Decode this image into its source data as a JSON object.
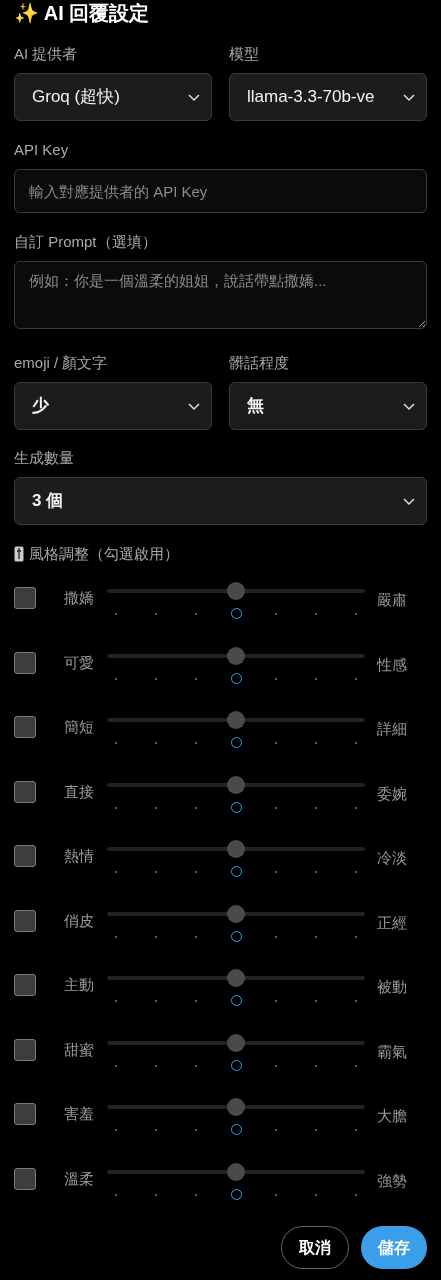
{
  "title": "✨ AI 回覆設定",
  "provider": {
    "label": "AI 提供者",
    "value": "Groq (超快)"
  },
  "model": {
    "label": "模型",
    "value": "llama-3.3-70b-ve"
  },
  "api_key": {
    "label": "API Key",
    "placeholder": "輸入對應提供者的 API Key"
  },
  "prompt": {
    "label": "自訂 Prompt（選填）",
    "placeholder": "例如：你是一個溫柔的姐姐，說話帶點撒嬌..."
  },
  "emoji": {
    "label": "emoji / 顏文字",
    "value": "少"
  },
  "profanity": {
    "label": "髒話程度",
    "value": "無"
  },
  "count": {
    "label": "生成數量",
    "value": "3 個"
  },
  "style_heading": "風格調整（勾選啟用）",
  "styles": [
    {
      "left": "撒嬌",
      "right": "嚴肅",
      "checked": false,
      "level": 0.5
    },
    {
      "left": "可愛",
      "right": "性感",
      "checked": false,
      "level": 0.5
    },
    {
      "left": "簡短",
      "right": "詳細",
      "checked": false,
      "level": 0.5
    },
    {
      "left": "直接",
      "right": "委婉",
      "checked": false,
      "level": 0.5
    },
    {
      "left": "熱情",
      "right": "冷淡",
      "checked": false,
      "level": 0.5
    },
    {
      "left": "俏皮",
      "right": "正經",
      "checked": false,
      "level": 0.5
    },
    {
      "left": "主動",
      "right": "被動",
      "checked": false,
      "level": 0.5
    },
    {
      "left": "甜蜜",
      "right": "霸氣",
      "checked": false,
      "level": 0.5
    },
    {
      "left": "害羞",
      "right": "大膽",
      "checked": false,
      "level": 0.5
    },
    {
      "left": "溫柔",
      "right": "強勢",
      "checked": false,
      "level": 0.5
    }
  ],
  "buttons": {
    "cancel": "取消",
    "save": "儲存"
  }
}
